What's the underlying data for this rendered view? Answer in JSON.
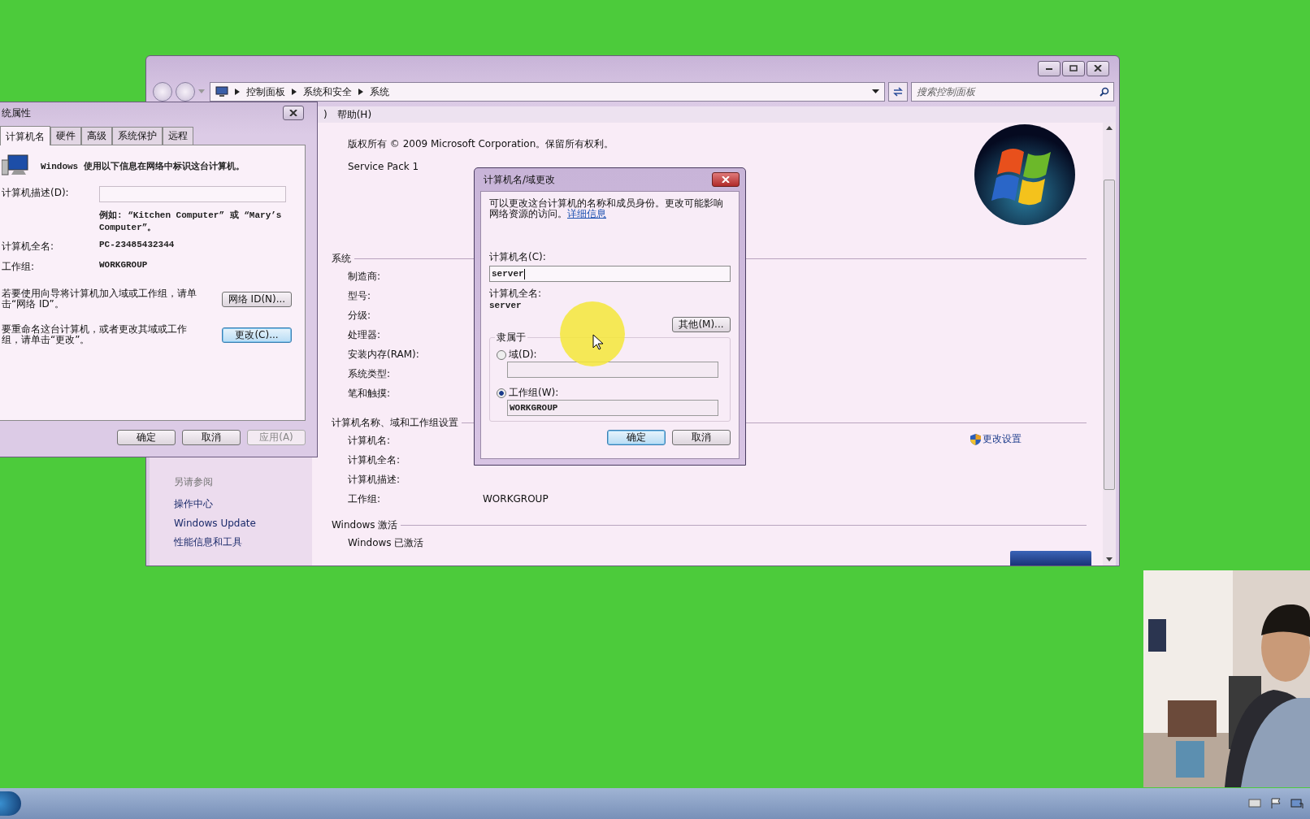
{
  "main_window": {
    "breadcrumbs": [
      "控制面板",
      "系统和安全",
      "系统"
    ],
    "search": {
      "placeholder": "搜索控制面板"
    },
    "menu_bar": [
      ")",
      "帮助(H)"
    ],
    "sidebar": {
      "heading": "另请参阅",
      "links": [
        "操作中心",
        "Windows Update",
        "性能信息和工具"
      ]
    },
    "edition": {
      "copyright": "版权所有 © 2009 Microsoft Corporation。保留所有权利。",
      "service_pack": "Service Pack 1"
    },
    "sections": [
      {
        "title": "系统",
        "rows": [
          {
            "label": "制造商:"
          },
          {
            "label": "型号:"
          },
          {
            "label": "分级:"
          },
          {
            "label": "处理器:"
          },
          {
            "label": "安装内存(RAM):"
          },
          {
            "label": "系统类型:"
          },
          {
            "label": "笔和触摸:"
          }
        ]
      },
      {
        "title": "计算机名称、域和工作组设置",
        "action": "更改设置",
        "rows": [
          {
            "label": "计算机名:"
          },
          {
            "label": "计算机全名:"
          },
          {
            "label": "计算机描述:"
          },
          {
            "label": "工作组:",
            "value": "WORKGROUP"
          }
        ]
      },
      {
        "title": "Windows 激活",
        "rows": [
          {
            "label": "Windows 已激活"
          }
        ]
      }
    ]
  },
  "properties_dialog": {
    "title": "统属性",
    "tabs": [
      {
        "label": "计算机名",
        "selected": true
      },
      {
        "label": "硬件",
        "selected": false
      },
      {
        "label": "高级",
        "selected": false
      },
      {
        "label": "系统保护",
        "selected": false
      },
      {
        "label": "远程",
        "selected": false
      }
    ],
    "intro": "Windows 使用以下信息在网络中标识这台计算机。",
    "description_label": "计算机描述(D):",
    "example": "例如: “Kitchen Computer” 或 “Mary’s Computer”。",
    "full_name_label": "计算机全名:",
    "full_name": "PC-23485432344",
    "workgroup_label": "工作组:",
    "workgroup": "WORKGROUP",
    "actions": [
      {
        "text": "若要使用向导将计算机加入域或工作组，请单击“网络 ID”。",
        "button": {
          "label": "网络 ID(N)...",
          "default": false
        }
      },
      {
        "text": "要重命名这台计算机，或者更改其域或工作组，请单击“更改”。",
        "button": {
          "label": "更改(C)...",
          "default": true
        }
      }
    ],
    "buttons": [
      {
        "label": "确定",
        "default": false,
        "disabled": false
      },
      {
        "label": "取消",
        "default": false,
        "disabled": false
      },
      {
        "label": "应用(A)",
        "default": false,
        "disabled": true
      }
    ]
  },
  "rename_dialog": {
    "title": "计算机名/域更改",
    "intro": "可以更改这台计算机的名称和成员身份。更改可能影响网络资源的访问。",
    "link": "详细信息",
    "name_label": "计算机名(C):",
    "name": "server",
    "full_name_label": "计算机全名:",
    "full_name": "server",
    "more_button": "其他(M)...",
    "member_of": "隶属于",
    "options": [
      {
        "label": "域(D):",
        "selected": false
      },
      {
        "label": "工作组(W):",
        "selected": true,
        "value": "WORKGROUP"
      }
    ],
    "buttons": [
      {
        "label": "确定",
        "default": true,
        "disabled": false
      },
      {
        "label": "取消",
        "default": false,
        "disabled": false
      }
    ]
  }
}
